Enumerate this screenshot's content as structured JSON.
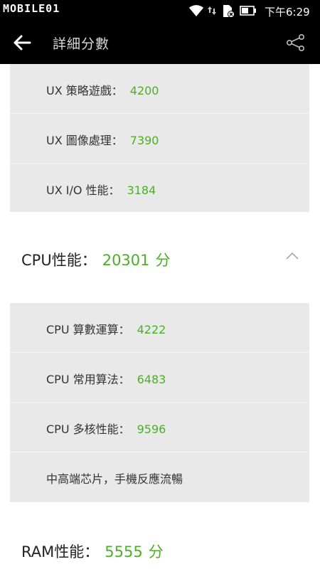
{
  "status_bar": {
    "watermark": "MOBILE01",
    "time": "下午6:29",
    "icons": [
      "wifi-icon",
      "data-arrows-icon",
      "sd-card-icon",
      "battery-icon"
    ]
  },
  "app_bar": {
    "title": "詳細分數",
    "back_icon": "arrow-left-icon",
    "share_icon": "share-icon"
  },
  "ux_sub": [
    {
      "label": "UX 策略遊戲：",
      "value": "4200"
    },
    {
      "label": "UX 圖像處理：",
      "value": "7390"
    },
    {
      "label": "UX I/O 性能：",
      "value": "3184"
    }
  ],
  "cpu": {
    "label": "CPU性能：",
    "value": "20301",
    "unit": "分",
    "sub": [
      {
        "label": "CPU 算數運算：",
        "value": "4222"
      },
      {
        "label": "CPU 常用算法：",
        "value": "6483"
      },
      {
        "label": "CPU 多核性能：",
        "value": "9596"
      },
      {
        "label": "中高端芯片，手機反應流暢",
        "value": ""
      }
    ]
  },
  "ram": {
    "label": "RAM性能：",
    "value": "5555",
    "unit": "分"
  },
  "colors": {
    "score_green": "#4caf27",
    "panel_gray": "#e9e9e9",
    "bar_black": "#000000"
  }
}
